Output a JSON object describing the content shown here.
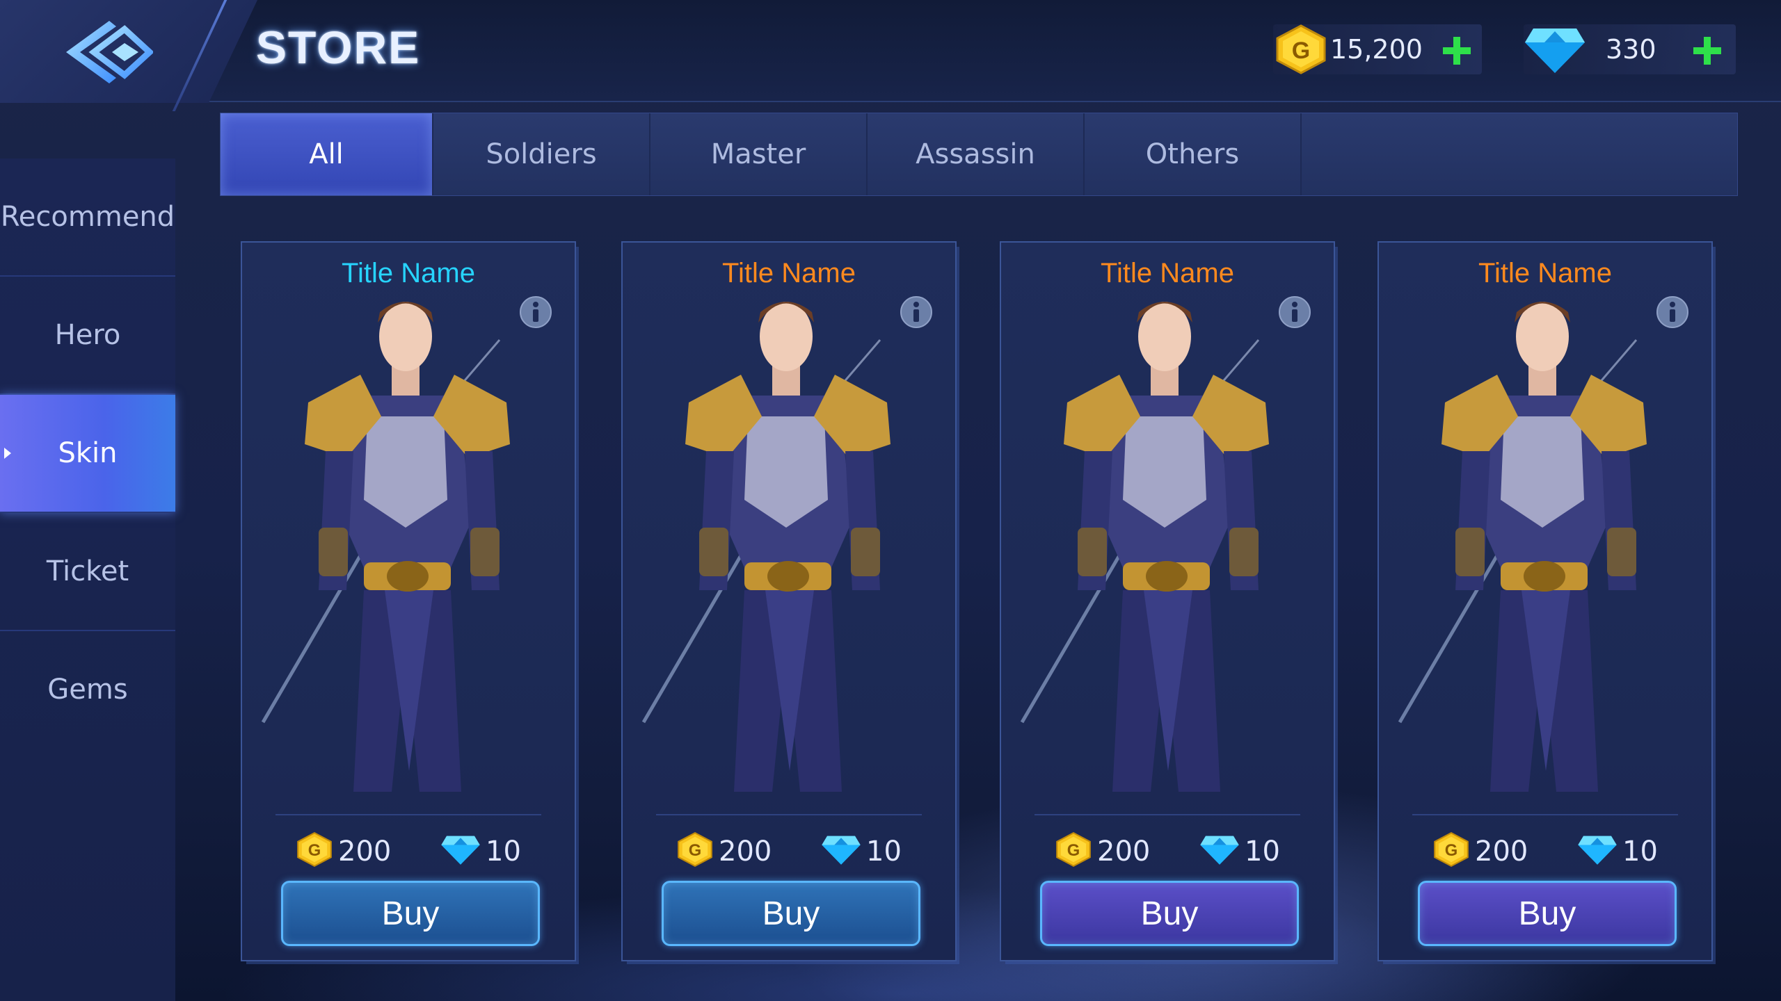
{
  "header": {
    "title": "STORE",
    "gold_amount": "15,200",
    "gem_amount": "330"
  },
  "tabs": [
    {
      "label": "All",
      "active": true
    },
    {
      "label": "Soldiers",
      "active": false
    },
    {
      "label": "Master",
      "active": false
    },
    {
      "label": "Assassin",
      "active": false
    },
    {
      "label": "Others",
      "active": false
    }
  ],
  "sidebar": {
    "items": [
      {
        "label": "Recommend",
        "active": false
      },
      {
        "label": "Hero",
        "active": false
      },
      {
        "label": "Skin",
        "active": true
      },
      {
        "label": "Ticket",
        "active": false
      },
      {
        "label": "Gems",
        "active": false
      }
    ]
  },
  "cards": [
    {
      "title": "Title Name",
      "title_color": "#27d4ff",
      "gold_price": "200",
      "gem_price": "10",
      "buy_label": "Buy",
      "button_style": "blue"
    },
    {
      "title": "Title Name",
      "title_color": "#ff8a1e",
      "gold_price": "200",
      "gem_price": "10",
      "buy_label": "Buy",
      "button_style": "blue"
    },
    {
      "title": "Title Name",
      "title_color": "#ff8a1e",
      "gold_price": "200",
      "gem_price": "10",
      "buy_label": "Buy",
      "button_style": "purple"
    },
    {
      "title": "Title Name",
      "title_color": "#ff8a1e",
      "gold_price": "200",
      "gem_price": "10",
      "buy_label": "Buy",
      "button_style": "purple"
    }
  ],
  "icons": {
    "gold": "gold-coin-icon",
    "gem": "diamond-gem-icon",
    "back": "back-arrow-icon",
    "info": "info-icon",
    "plus": "plus-icon"
  },
  "colors": {
    "gold": "#f7c21a",
    "gem": "#22c6ff",
    "plus": "#2ee04a",
    "active_tab": "#3f52c4",
    "active_sidebar": "#5a6cf0"
  }
}
